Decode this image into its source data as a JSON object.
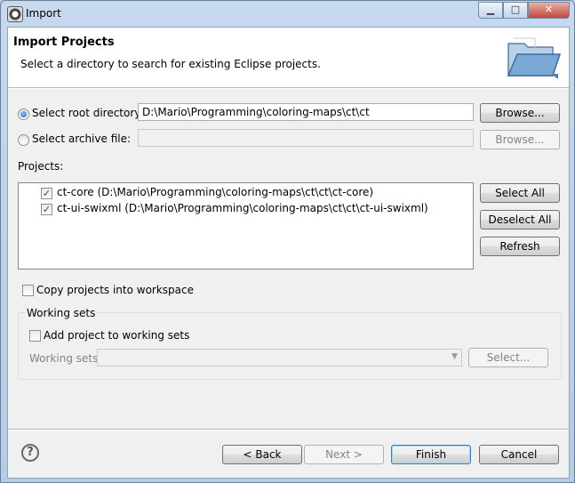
{
  "window": {
    "title": "Import",
    "min_icon": "minimize-icon",
    "max_icon": "maximize-icon",
    "close_icon": "close-icon"
  },
  "banner": {
    "title": "Import Projects",
    "description": "Select a directory to search for existing Eclipse projects."
  },
  "source": {
    "root_label": "Select root directory:",
    "root_value": "D:\\Mario\\Programming\\coloring-maps\\ct\\ct",
    "root_selected": true,
    "archive_label": "Select archive file:",
    "archive_value": "",
    "browse_label": "Browse...",
    "browse_archive_label": "Browse..."
  },
  "projects": {
    "label": "Projects:",
    "items": [
      {
        "label": "ct-core (D:\\Mario\\Programming\\coloring-maps\\ct\\ct\\ct-core)",
        "checked": true
      },
      {
        "label": "ct-ui-swixml (D:\\Mario\\Programming\\coloring-maps\\ct\\ct\\ct-ui-swixml)",
        "checked": true
      }
    ],
    "select_all": "Select All",
    "deselect_all": "Deselect All",
    "refresh": "Refresh"
  },
  "options": {
    "copy_label": "Copy projects into workspace",
    "copy_checked": false
  },
  "working_sets": {
    "group_label": "Working sets",
    "add_label": "Add project to working sets",
    "add_checked": false,
    "sets_label": "Working sets:",
    "sets_value": "",
    "select_label": "Select..."
  },
  "footer": {
    "help_icon": "help-icon",
    "back": "< Back",
    "next": "Next >",
    "finish": "Finish",
    "cancel": "Cancel"
  },
  "colors": {
    "frame": "#b9d1ea",
    "client": "#f0f0f0",
    "default_button_border": "#3c7fb1"
  }
}
